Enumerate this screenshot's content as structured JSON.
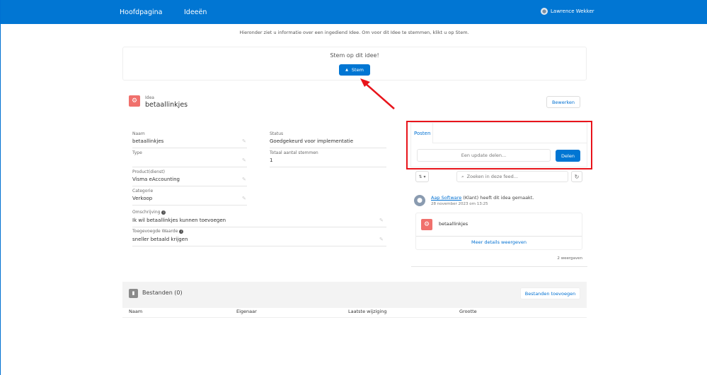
{
  "nav": {
    "home": "Hoofdpagina",
    "ideas": "Ideeën",
    "user": "Lawrence Wekker"
  },
  "intro": "Hieronder ziet u informatie over een ingediend Idee. Om voor dit Idee te stemmen, klikt u op Stem.",
  "vote": {
    "title": "Stem op dit idee!",
    "button": "Stem"
  },
  "record": {
    "type": "Idea",
    "title": "betaallinkjes",
    "edit": "Bewerken"
  },
  "fields": {
    "naam_label": "Naam",
    "naam": "betaallinkjes",
    "type_label": "Type",
    "type": "",
    "product_label": "Product(dienst)",
    "product": "Visma eAccounting",
    "categorie_label": "Categorie",
    "categorie": "Verkoop",
    "omschrijving_label": "Omschrijving",
    "omschrijving": "Ik wil betaallinkjes kunnen toevoegen",
    "waarde_label": "Toegevoegde Waarde",
    "waarde": "sneller betaald krijgen",
    "status_label": "Status",
    "status": "Goedgekeurd voor implementatie",
    "stemmen_label": "Totaal aantal stemmen",
    "stemmen": "1"
  },
  "feed": {
    "tab": "Posten",
    "placeholder": "Een update delen...",
    "share": "Delen",
    "search_placeholder": "Zoeken in deze feed...",
    "author": "Aap Software",
    "author_suffix": " (Klant) heeft dit idea gemaakt.",
    "date": "28 november 2023 om 13:25",
    "card_title": "betaallinkjes",
    "more": "Meer details weergeven",
    "views": "2 weergaven"
  },
  "files": {
    "title": "Bestanden (0)",
    "add": "Bestanden toevoegen",
    "columns": [
      "Naam",
      "Eigenaar",
      "Laatste wijziging",
      "Grootte"
    ]
  },
  "colors": {
    "brand": "#0176d3",
    "annotation": "#e8141b",
    "idea_icon": "#f0706c"
  }
}
